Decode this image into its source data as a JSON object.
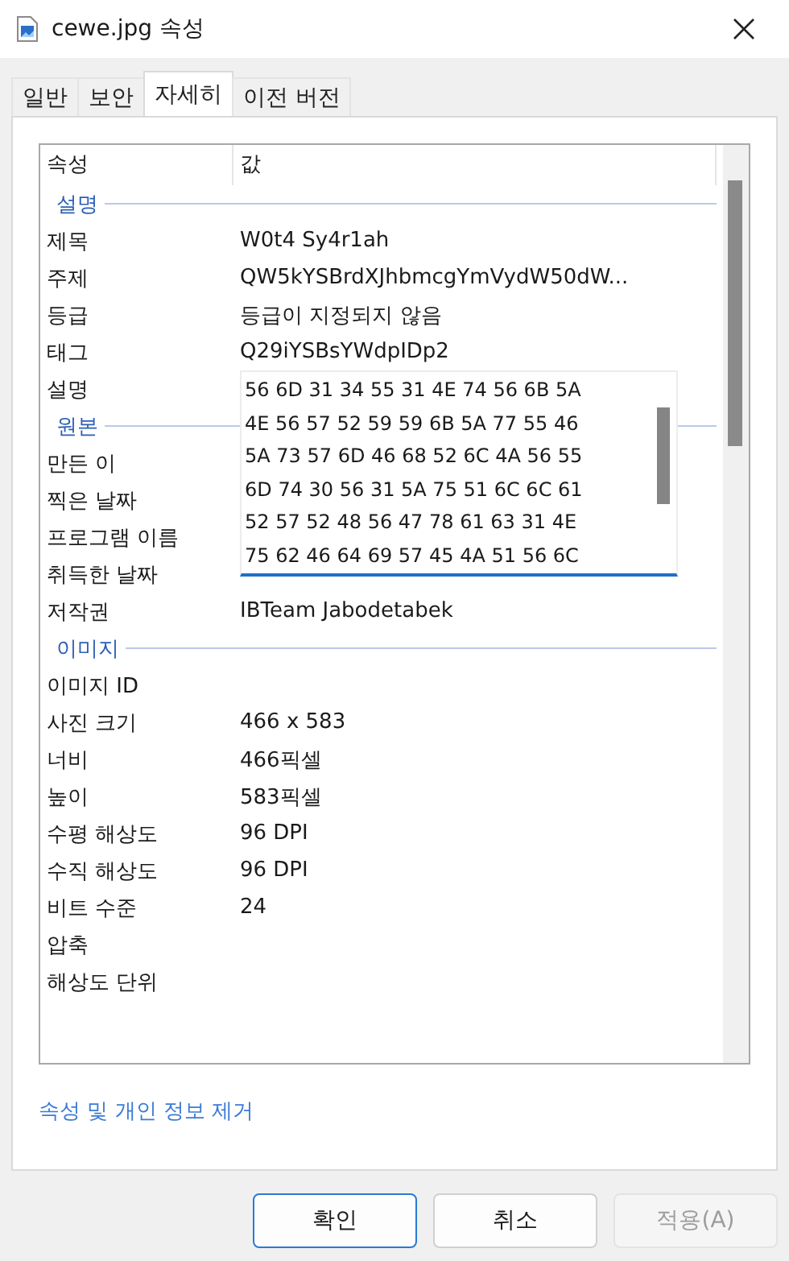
{
  "window": {
    "title": "cewe.jpg 속성"
  },
  "tabs": [
    {
      "label": "일반",
      "selected": false
    },
    {
      "label": "보안",
      "selected": false
    },
    {
      "label": "자세히",
      "selected": true
    },
    {
      "label": "이전 버전",
      "selected": false
    }
  ],
  "table": {
    "columns": [
      "속성",
      "값"
    ],
    "groups": [
      {
        "name": "설명",
        "rows": [
          {
            "kind": "text",
            "label": "제목",
            "value": "W0t4 Sy4r1ah"
          },
          {
            "kind": "text",
            "label": "주제",
            "value": "QW5kYSBrdXJhbmcgYmVydW50dW..."
          },
          {
            "kind": "text",
            "label": "등급",
            "value": "등급이 지정되지 않음"
          },
          {
            "kind": "text",
            "label": "태그",
            "value": "Q29iYSBsYWdpIDp2"
          },
          {
            "kind": "editing",
            "label": "설명",
            "lines": [
              "56 6D 31 34 55 31 4E 74 56 6B 5A",
              "4E 56 57 52 59 59 6B 5A 77 55 46",
              "5A 73 57 6D 46 68 52 6C 4A 56 55",
              "6D 74 30 56 31 5A 75 51 6C 6C 61",
              "52 57 52 48 56 47 78 61 63 31 4E",
              "75 62 46 64 69 57 45 4A 51 56 6C"
            ]
          }
        ]
      },
      {
        "name": "원본",
        "rows": [
          {
            "kind": "text",
            "label": "만든 이"
          },
          {
            "kind": "text",
            "label": "찍은 날짜"
          },
          {
            "kind": "text",
            "label": "프로그램 이름"
          },
          {
            "kind": "text",
            "label": "취득한 날짜"
          },
          {
            "kind": "text",
            "label": "저작권",
            "value": "IBTeam Jabodetabek"
          }
        ]
      },
      {
        "name": "이미지",
        "rows": [
          {
            "kind": "text",
            "label": "이미지 ID"
          },
          {
            "kind": "text",
            "label": "사진 크기",
            "value": "466 x 583"
          },
          {
            "kind": "text",
            "label": "너비",
            "value": "466픽셀"
          },
          {
            "kind": "text",
            "label": "높이",
            "value": "583픽셀"
          },
          {
            "kind": "text",
            "label": "수평 해상도",
            "value": "96 DPI"
          },
          {
            "kind": "text",
            "label": "수직 해상도",
            "value": "96 DPI"
          },
          {
            "kind": "text",
            "label": "비트 수준",
            "value": "24"
          },
          {
            "kind": "text",
            "label": "압축"
          },
          {
            "kind": "text",
            "label": "해상도 단위"
          }
        ]
      }
    ]
  },
  "link": "속성 및 개인 정보 제거",
  "buttons": [
    {
      "label": "확인",
      "default": true,
      "disabled": false
    },
    {
      "label": "취소",
      "default": false,
      "disabled": false
    },
    {
      "label": "적용(A)",
      "default": false,
      "disabled": true
    }
  ]
}
